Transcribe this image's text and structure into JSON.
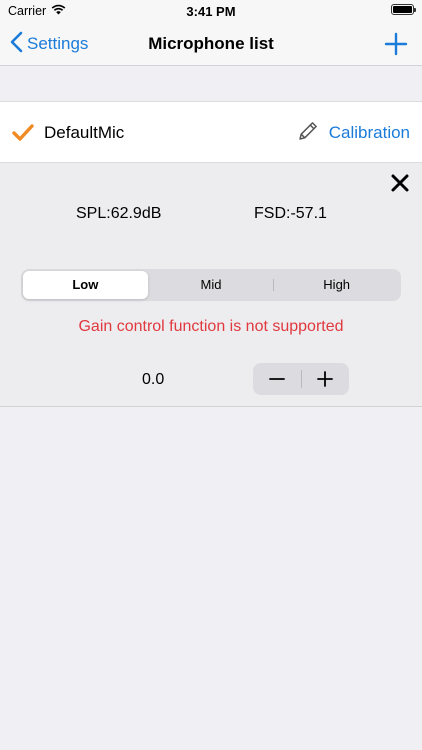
{
  "status_bar": {
    "carrier": "Carrier",
    "time": "3:41 PM",
    "icons": [
      "wifi-icon",
      "battery-icon"
    ]
  },
  "nav": {
    "back_label": "Settings",
    "title": "Microphone list",
    "add_icon": "plus-icon"
  },
  "mic_row": {
    "name": "DefaultMic",
    "selected": true,
    "calibration_label": "Calibration",
    "icons": [
      "checkmark-icon",
      "pencil-icon"
    ]
  },
  "panel": {
    "spl": "SPL:62.9dB",
    "fsd": "FSD:-57.1",
    "segments": [
      "Low",
      "Mid",
      "High"
    ],
    "selected_segment": "Low",
    "error": "Gain control function is not supported",
    "gain_value": "0.0",
    "stepper_minus": "−",
    "stepper_plus": "+"
  },
  "colors": {
    "accent": "#1a7bd9",
    "check": "#f08a24",
    "error": "#e0393e",
    "background": "#efeff4"
  }
}
